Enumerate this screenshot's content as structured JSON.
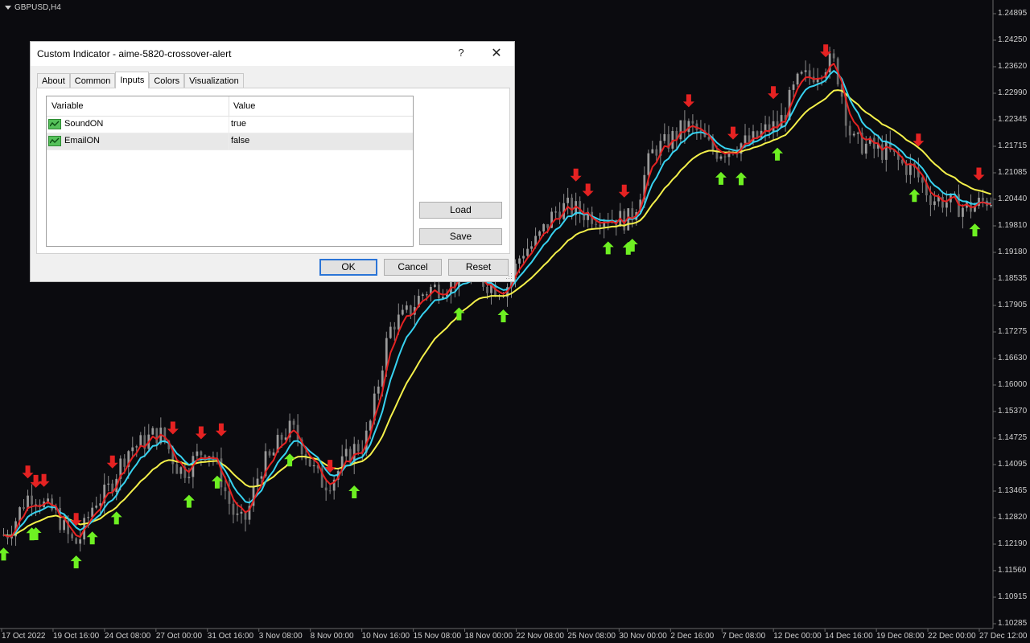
{
  "chart": {
    "symbol": "GBPUSD,H4",
    "background": "#0b0b0f",
    "price_labels": [
      "1.24895",
      "1.24250",
      "1.23620",
      "1.22990",
      "1.22345",
      "1.21715",
      "1.21085",
      "1.20440",
      "1.19810",
      "1.19180",
      "1.18535",
      "1.17905",
      "1.17275",
      "1.16630",
      "1.16000",
      "1.15370",
      "1.14725",
      "1.14095",
      "1.13465",
      "1.12820",
      "1.12190",
      "1.11560",
      "1.10915",
      "1.10285"
    ],
    "time_labels": [
      "17 Oct 2022",
      "19 Oct 16:00",
      "24 Oct 08:00",
      "27 Oct 00:00",
      "31 Oct 16:00",
      "3 Nov 08:00",
      "8 Nov 00:00",
      "10 Nov 16:00",
      "15 Nov 08:00",
      "18 Nov 00:00",
      "22 Nov 08:00",
      "25 Nov 08:00",
      "30 Nov 00:00",
      "2 Dec 16:00",
      "7 Dec 08:00",
      "12 Dec 00:00",
      "14 Dec 16:00",
      "19 Dec 08:00",
      "22 Dec 00:00",
      "27 Dec 12:00"
    ],
    "colors": {
      "fast_ma": "#e52222",
      "mid_ma": "#37d2f0",
      "slow_ma": "#f4f04a",
      "up_arrow": "#6ef022",
      "down_arrow": "#e52222",
      "candles": "#8a8a8a"
    }
  },
  "chart_data": {
    "type": "line",
    "ylim": [
      1.101,
      1.252
    ],
    "x_count": 246,
    "price_anchors": [
      [
        0,
        1.123
      ],
      [
        12,
        1.133
      ],
      [
        20,
        1.129
      ],
      [
        30,
        1.121
      ],
      [
        40,
        1.132
      ],
      [
        55,
        1.145
      ],
      [
        65,
        1.148
      ],
      [
        75,
        1.139
      ],
      [
        85,
        1.144
      ],
      [
        100,
        1.126
      ],
      [
        110,
        1.141
      ],
      [
        120,
        1.149
      ],
      [
        135,
        1.136
      ],
      [
        150,
        1.145
      ],
      [
        165,
        1.176
      ],
      [
        180,
        1.184
      ],
      [
        195,
        1.187
      ],
      [
        210,
        1.184
      ],
      [
        220,
        1.194
      ],
      [
        235,
        1.204
      ],
      [
        250,
        1.202
      ],
      [
        262,
        1.201
      ],
      [
        275,
        1.219
      ],
      [
        288,
        1.224
      ],
      [
        300,
        1.218
      ],
      [
        312,
        1.22
      ],
      [
        324,
        1.224
      ],
      [
        336,
        1.236
      ],
      [
        348,
        1.24
      ],
      [
        358,
        1.22
      ],
      [
        370,
        1.218
      ],
      [
        380,
        1.214
      ],
      [
        392,
        1.206
      ],
      [
        405,
        1.204
      ],
      [
        415,
        1.206
      ]
    ],
    "up_arrow_x": [
      0,
      12,
      14,
      30,
      38,
      48,
      78,
      89,
      120,
      148,
      192,
      210,
      254,
      262,
      264,
      302,
      310,
      325,
      382,
      408
    ],
    "down_arrow_x": [
      11,
      13,
      17,
      31,
      46,
      71,
      83,
      92,
      138,
      241,
      246,
      261,
      288,
      307,
      324,
      346,
      384,
      410
    ]
  },
  "dialog": {
    "title": "Custom Indicator - aime-5820-crossover-alert",
    "help_label": "?",
    "close_label": "✕",
    "tabs": [
      {
        "label": "About"
      },
      {
        "label": "Common"
      },
      {
        "label": "Inputs"
      },
      {
        "label": "Colors"
      },
      {
        "label": "Visualization"
      }
    ],
    "active_tab": "Inputs",
    "grid": {
      "col_variable": "Variable",
      "col_value": "Value",
      "rows": [
        {
          "name": "SoundON",
          "value": "true"
        },
        {
          "name": "EmailON",
          "value": "false"
        }
      ]
    },
    "load_label": "Load",
    "save_label": "Save",
    "ok_label": "OK",
    "cancel_label": "Cancel",
    "reset_label": "Reset"
  }
}
